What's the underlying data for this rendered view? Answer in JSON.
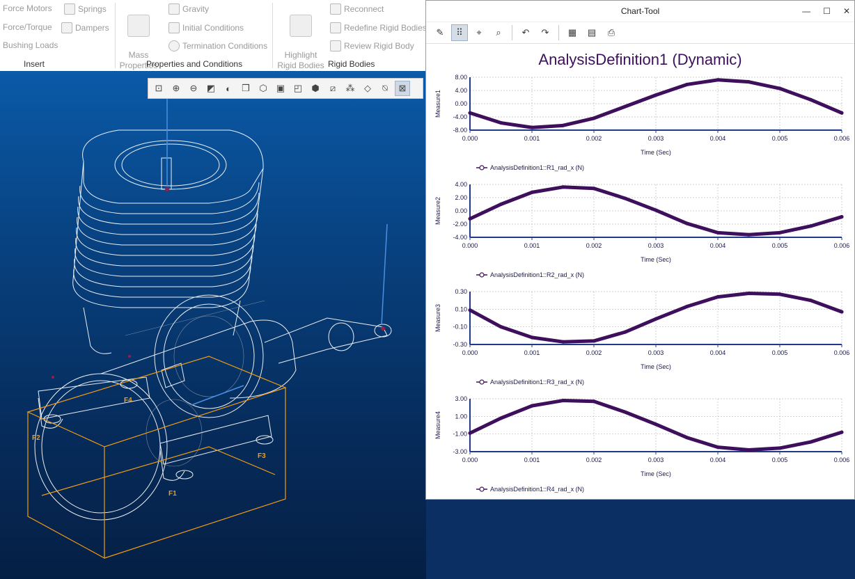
{
  "ribbon": {
    "insert": {
      "force_motors": "Force Motors",
      "springs": "Springs",
      "force_torque": "Force/Torque",
      "dampers": "Dampers",
      "bushing_loads": "Bushing Loads",
      "group_label": "Insert"
    },
    "properties": {
      "mass_properties": "Mass\nProperties",
      "gravity": "Gravity",
      "initial_conditions": "Initial Conditions",
      "termination_conditions": "Termination Conditions",
      "group_label": "Properties and Conditions"
    },
    "rigid_bodies": {
      "highlight": "Highlight\nRigid Bodies",
      "reconnect": "Reconnect",
      "redefine": "Redefine Rigid Bodies",
      "review": "Review Rigid Body",
      "group_label": "Rigid Bodies"
    }
  },
  "viewport_toolbar": {
    "icons": [
      "refit-icon",
      "zoom-in-icon",
      "zoom-out-icon",
      "repaint-icon",
      "display-style-icon",
      "orientation-icon",
      "saved-views-icon",
      "view-manager-icon",
      "perspective-icon",
      "section-icon",
      "datum-display-icon",
      "annotation-display-icon",
      "spin-center-icon",
      "model-display-icon"
    ]
  },
  "chart_tool": {
    "window_title": "Chart-Tool",
    "window_controls": {
      "minimize": "—",
      "maximize": "☐",
      "close": "✕"
    },
    "toolbar_icons": [
      "edit-icon",
      "grid-icon",
      "xy-coords-icon",
      "zoom-icon",
      "undo-icon",
      "redo-icon",
      "table-icon",
      "export-text-icon",
      "print-icon"
    ],
    "title": "AnalysisDefinition1 (Dynamic)",
    "line_color": "#3d0f5c"
  },
  "chart_data": [
    {
      "type": "line",
      "title": "",
      "xlabel": "Time (Sec)",
      "ylabel": "Measure1",
      "xlim": [
        0,
        0.006
      ],
      "ylim": [
        -8,
        8
      ],
      "xticks": [
        "0.000",
        "0.001",
        "0.002",
        "0.003",
        "0.004",
        "0.005",
        "0.006"
      ],
      "yticks": [
        "8.00",
        "4.00",
        "0.00",
        "-4.00",
        "-8.00"
      ],
      "series": [
        {
          "name": "AnalysisDefinition1::R1_rad_x (N)",
          "x": [
            0,
            0.0005,
            0.001,
            0.0015,
            0.002,
            0.0025,
            0.003,
            0.0035,
            0.004,
            0.0045,
            0.005,
            0.0055,
            0.006
          ],
          "y": [
            -2.8,
            -5.8,
            -7.2,
            -6.6,
            -4.4,
            -0.9,
            2.6,
            5.8,
            7.2,
            6.6,
            4.6,
            1.2,
            -2.8
          ]
        }
      ]
    },
    {
      "type": "line",
      "title": "",
      "xlabel": "Time (Sec)",
      "ylabel": "Measure2",
      "xlim": [
        0,
        0.006
      ],
      "ylim": [
        -4,
        4
      ],
      "xticks": [
        "0.000",
        "0.001",
        "0.002",
        "0.003",
        "0.004",
        "0.005",
        "0.006"
      ],
      "yticks": [
        "4.00",
        "2.00",
        "0.00",
        "-2.00",
        "-4.00"
      ],
      "series": [
        {
          "name": "AnalysisDefinition1::R2_rad_x (N)",
          "x": [
            0,
            0.0005,
            0.001,
            0.0015,
            0.002,
            0.0025,
            0.003,
            0.0035,
            0.004,
            0.0045,
            0.005,
            0.0055,
            0.006
          ],
          "y": [
            -1.2,
            1.0,
            2.8,
            3.6,
            3.4,
            1.9,
            0.1,
            -1.9,
            -3.3,
            -3.6,
            -3.3,
            -2.3,
            -0.9
          ]
        }
      ]
    },
    {
      "type": "line",
      "title": "",
      "xlabel": "Time (Sec)",
      "ylabel": "Measure3",
      "xlim": [
        0,
        0.006
      ],
      "ylim": [
        -0.3,
        0.3
      ],
      "xticks": [
        "0.000",
        "0.001",
        "0.002",
        "0.003",
        "0.004",
        "0.005",
        "0.006"
      ],
      "yticks": [
        "0.30",
        "0.10",
        "-0.10",
        "-0.30"
      ],
      "series": [
        {
          "name": "AnalysisDefinition1::R3_rad_x (N)",
          "x": [
            0,
            0.0005,
            0.001,
            0.0015,
            0.002,
            0.0025,
            0.003,
            0.0035,
            0.004,
            0.0045,
            0.005,
            0.0055,
            0.006
          ],
          "y": [
            0.09,
            -0.1,
            -0.22,
            -0.27,
            -0.26,
            -0.16,
            -0.01,
            0.13,
            0.24,
            0.28,
            0.27,
            0.2,
            0.07
          ]
        }
      ]
    },
    {
      "type": "line",
      "title": "",
      "xlabel": "Time (Sec)",
      "ylabel": "Measure4",
      "xlim": [
        0,
        0.006
      ],
      "ylim": [
        -3,
        3
      ],
      "xticks": [
        "0.000",
        "0.001",
        "0.002",
        "0.003",
        "0.004",
        "0.005",
        "0.006"
      ],
      "yticks": [
        "3.00",
        "1.00",
        "-1.00",
        "-3.00"
      ],
      "series": [
        {
          "name": "AnalysisDefinition1::R4_rad_x (N)",
          "x": [
            0,
            0.0005,
            0.001,
            0.0015,
            0.002,
            0.0025,
            0.003,
            0.0035,
            0.004,
            0.0045,
            0.005,
            0.0055,
            0.006
          ],
          "y": [
            -0.9,
            0.8,
            2.2,
            2.8,
            2.7,
            1.5,
            0.1,
            -1.4,
            -2.5,
            -2.8,
            -2.6,
            -1.9,
            -0.8
          ]
        }
      ]
    }
  ]
}
